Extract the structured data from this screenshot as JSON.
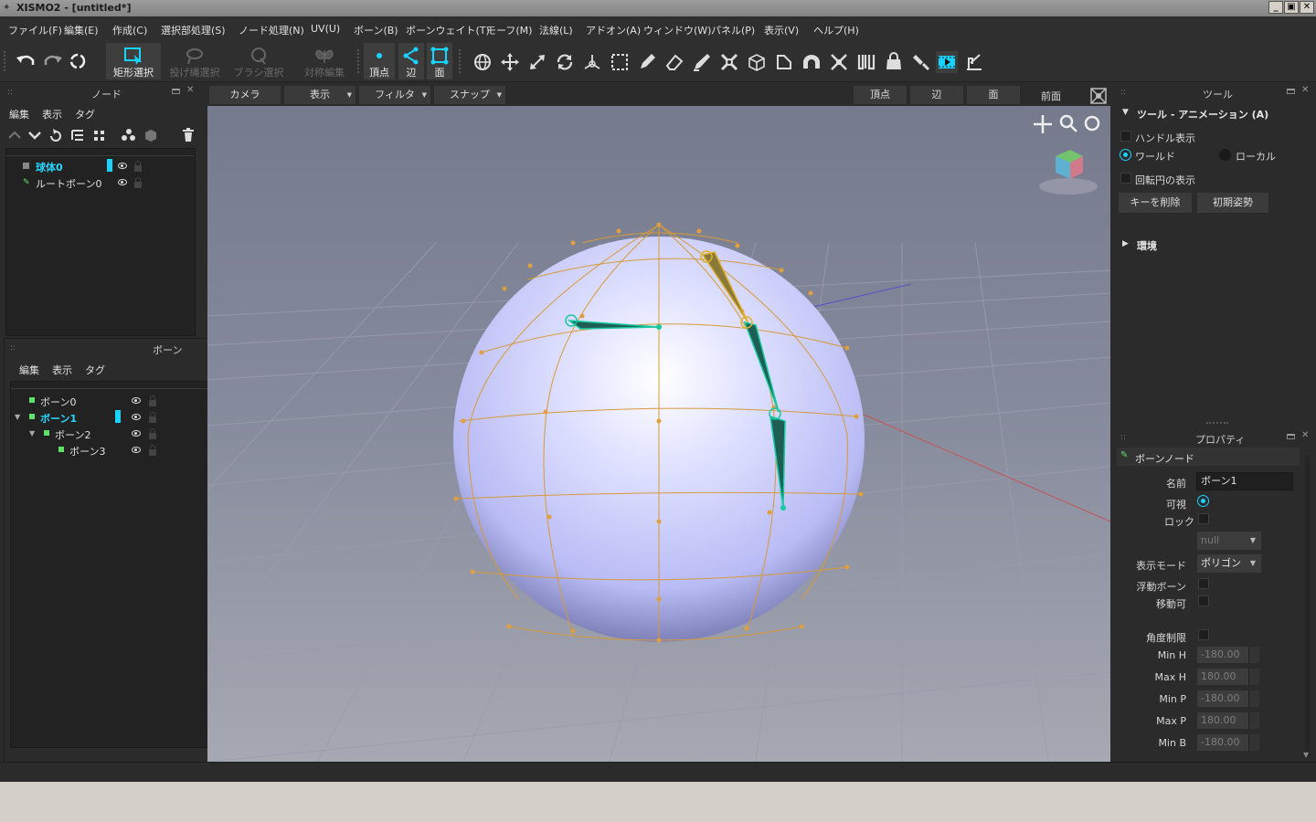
{
  "window": {
    "title": "XISMO2 - [untitled*]"
  },
  "menu": [
    "ファイル(F)",
    "編集(E)",
    "作成(C)",
    "選択部処理(S)",
    "ノード処理(N)",
    "UV(U)",
    "ボーン(B)",
    "ボーンウェイト(T)",
    "モーフ(M)",
    "法線(L)",
    "アドオン(A)",
    "ウィンドウ(W)",
    "パネル(P)",
    "表示(V)",
    "ヘルプ(H)"
  ],
  "toolbar": {
    "rect_select": "矩形選択",
    "lasso_select": "投げ縄選択",
    "brush_select": "ブラシ選択",
    "symmetric_edit": "対称編集",
    "vertex": "頂点",
    "edge": "辺",
    "face": "面"
  },
  "node_panel": {
    "title": "ノード",
    "menu": [
      "編集",
      "表示",
      "タグ"
    ],
    "items": [
      {
        "label": "球体0",
        "selected": true
      },
      {
        "label": "ルートボーン0",
        "selected": false
      }
    ]
  },
  "bone_panel": {
    "title": "ボーン",
    "menu": [
      "編集",
      "表示",
      "タグ"
    ],
    "items": [
      {
        "label": "ボーン0",
        "selected": false
      },
      {
        "label": "ボーン1",
        "selected": true
      },
      {
        "label": "ボーン2",
        "selected": false
      },
      {
        "label": "ボーン3",
        "selected": false
      }
    ]
  },
  "viewport": {
    "camera": "カメラ",
    "display": "表示",
    "filter": "フィルタ",
    "snap": "スナップ",
    "vertex": "頂点",
    "edge": "辺",
    "face": "面",
    "view_name": "前面"
  },
  "tool_panel": {
    "title": "ツール",
    "section": "ツール - アニメーション (A)",
    "handle_display": "ハンドル表示",
    "world": "ワールド",
    "local": "ローカル",
    "rotation_circle": "回転円の表示",
    "delete_key": "キーを削除",
    "initial_pose": "初期姿勢",
    "environment": "環境"
  },
  "property_panel": {
    "title": "プロパティ",
    "node_type": "ボーンノード",
    "name_label": "名前",
    "name_value": "ボーン1",
    "visible_label": "可視",
    "lock_label": "ロック",
    "parent_value": "null",
    "display_mode_label": "表示モード",
    "display_mode_value": "ポリゴン",
    "floating_bone_label": "浮動ボーン",
    "movable_label": "移動可",
    "angle_limit_label": "角度制限",
    "limits": [
      {
        "label": "Min H",
        "value": "-180.00"
      },
      {
        "label": "Max H",
        "value": "180.00"
      },
      {
        "label": "Min P",
        "value": "-180.00"
      },
      {
        "label": "Max P",
        "value": "180.00"
      },
      {
        "label": "Min B",
        "value": "-180.00"
      }
    ]
  },
  "colors": {
    "accent": "#19d3ff",
    "mesh_edge": "#d79a3a",
    "bone": "#16c9a0",
    "viewport_top": "#7b7f91",
    "sphere": "#c7c9ff"
  }
}
